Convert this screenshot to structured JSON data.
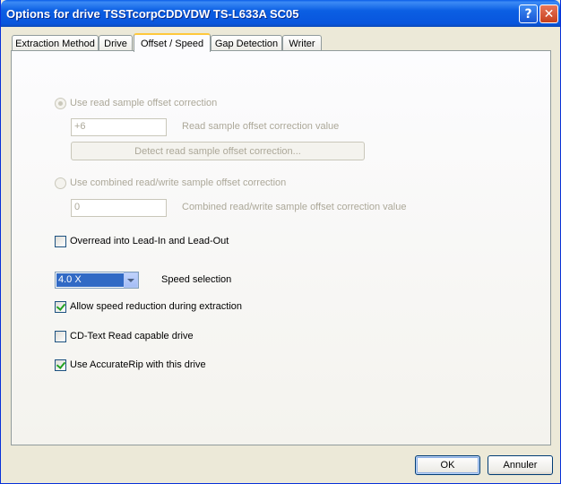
{
  "window": {
    "title": "Options for drive TSSTcorpCDDVDW TS-L633A SC05"
  },
  "tabs": [
    {
      "label": "Extraction Method"
    },
    {
      "label": "Drive"
    },
    {
      "label": "Offset / Speed"
    },
    {
      "label": "Gap Detection"
    },
    {
      "label": "Writer"
    }
  ],
  "offset": {
    "read_offset_radio": "Use read sample offset correction",
    "read_offset_value": "+6",
    "read_offset_value_label": "Read sample offset correction value",
    "detect_button": "Detect read sample offset correction...",
    "combined_radio": "Use combined read/write sample offset correction",
    "combined_value": "0",
    "combined_value_label": "Combined read/write sample offset correction value",
    "overread_label": "Overread into Lead-In and Lead-Out"
  },
  "speed": {
    "selected": "4.0 X",
    "label": "Speed selection",
    "allow_reduction_label": "Allow speed reduction during extraction",
    "cdtext_label": "CD-Text Read capable drive",
    "accuraterip_label": "Use AccurateRip with this drive"
  },
  "buttons": {
    "ok": "OK",
    "cancel": "Annuler"
  }
}
